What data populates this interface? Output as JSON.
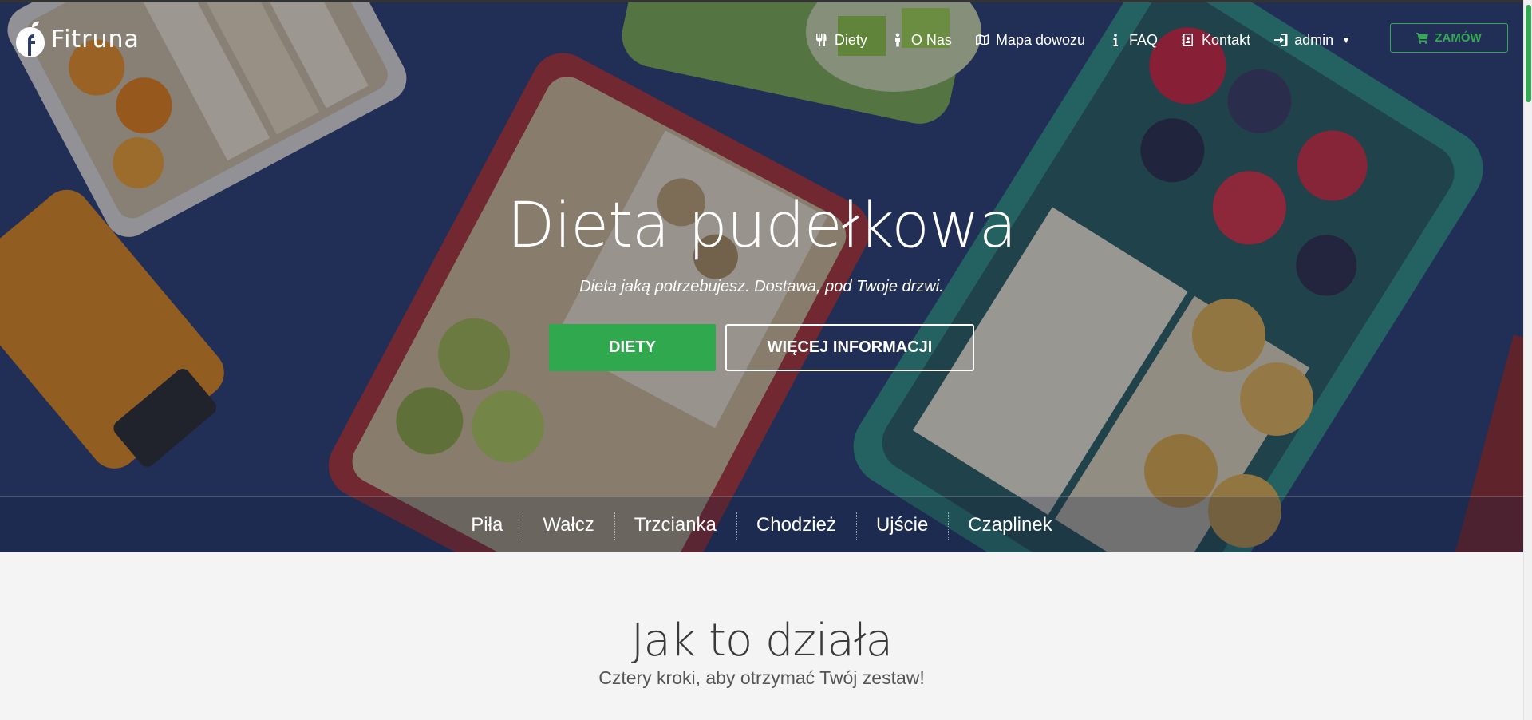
{
  "brand": {
    "name": "Fitruna",
    "accent_color": "#35a853"
  },
  "nav": {
    "items": [
      {
        "label": "Diety",
        "icon": "cutlery-icon"
      },
      {
        "label": "O Nas",
        "icon": "person-icon"
      },
      {
        "label": "Mapa dowozu",
        "icon": "map-icon"
      },
      {
        "label": "FAQ",
        "icon": "info-icon"
      },
      {
        "label": "Kontakt",
        "icon": "address-book-icon"
      },
      {
        "label": "admin",
        "icon": "sign-in-icon"
      }
    ],
    "order_label": "ZAMÓW",
    "order_icon": "cart-icon"
  },
  "hero": {
    "title": "Dieta pudełkowa",
    "subtitle": "Dieta jaką potrzebujesz. Dostawa, pod Twoje drzwi.",
    "primary_button": "DIETY",
    "secondary_button": "WIĘCEJ INFORMACJI"
  },
  "cities": [
    "Piła",
    "Wałcz",
    "Trzcianka",
    "Chodzież",
    "Ujście",
    "Czaplinek"
  ],
  "how_it_works": {
    "title": "Jak to działa",
    "subtitle": "Cztery kroki, aby otrzymać Twój zestaw!"
  }
}
